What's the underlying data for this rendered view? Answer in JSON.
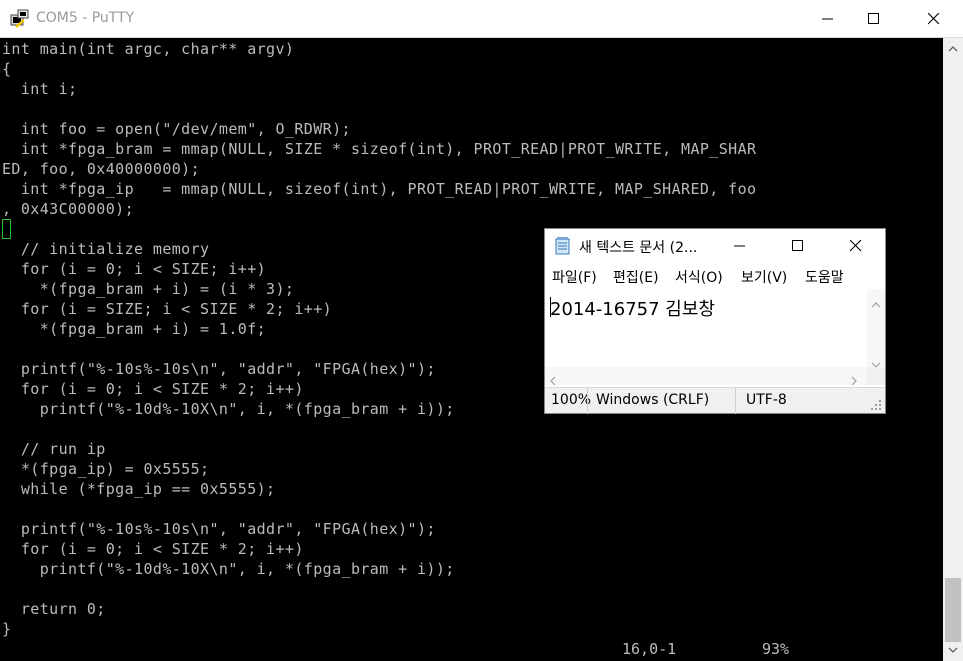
{
  "putty": {
    "title": "COM5 - PuTTY",
    "terminal_lines": [
      "int main(int argc, char** argv)",
      "{",
      "  int i;",
      "",
      "  int foo = open(\"/dev/mem\", O_RDWR);",
      "  int *fpga_bram = mmap(NULL, SIZE * sizeof(int), PROT_READ|PROT_WRITE, MAP_SHAR",
      "ED, foo, 0x40000000);",
      "  int *fpga_ip   = mmap(NULL, sizeof(int), PROT_READ|PROT_WRITE, MAP_SHARED, foo",
      ", 0x43C00000);",
      "",
      "  // initialize memory",
      "  for (i = 0; i < SIZE; i++)",
      "    *(fpga_bram + i) = (i * 3);",
      "  for (i = SIZE; i < SIZE * 2; i++)",
      "    *(fpga_bram + i) = 1.0f;",
      "",
      "  printf(\"%-10s%-10s\\n\", \"addr\", \"FPGA(hex)\");",
      "  for (i = 0; i < SIZE * 2; i++)",
      "    printf(\"%-10d%-10X\\n\", i, *(fpga_bram + i));",
      "",
      "  // run ip",
      "  *(fpga_ip) = 0x5555;",
      "  while (*fpga_ip == 0x5555);",
      "",
      "  printf(\"%-10s%-10s\\n\", \"addr\", \"FPGA(hex)\");",
      "  for (i = 0; i < SIZE * 2; i++)",
      "    printf(\"%-10d%-10X\\n\", i, *(fpga_bram + i));",
      "",
      "  return 0;",
      "}"
    ],
    "status_position": "16,0-1",
    "status_percent": "93%"
  },
  "notepad": {
    "title": "새 텍스트 문서 (2...",
    "menu": [
      "파일(F)",
      "편집(E)",
      "서식(O)",
      "보기(V)",
      "도움말"
    ],
    "content": "2014-16757 김보창",
    "status": {
      "zoom": "100%",
      "line_ending": "Windows (CRLF)",
      "encoding": "UTF-8"
    }
  },
  "colors": {
    "terminal_bg": "#000000",
    "terminal_fg": "#bbbbbb",
    "cursor": "#22c02a"
  },
  "icons": [
    "putty-icon",
    "minimize-icon",
    "maximize-icon",
    "close-icon",
    "notepad-icon",
    "scroll-up-icon",
    "scroll-down-icon",
    "scroll-left-icon",
    "scroll-right-icon",
    "resize-grip-icon"
  ]
}
